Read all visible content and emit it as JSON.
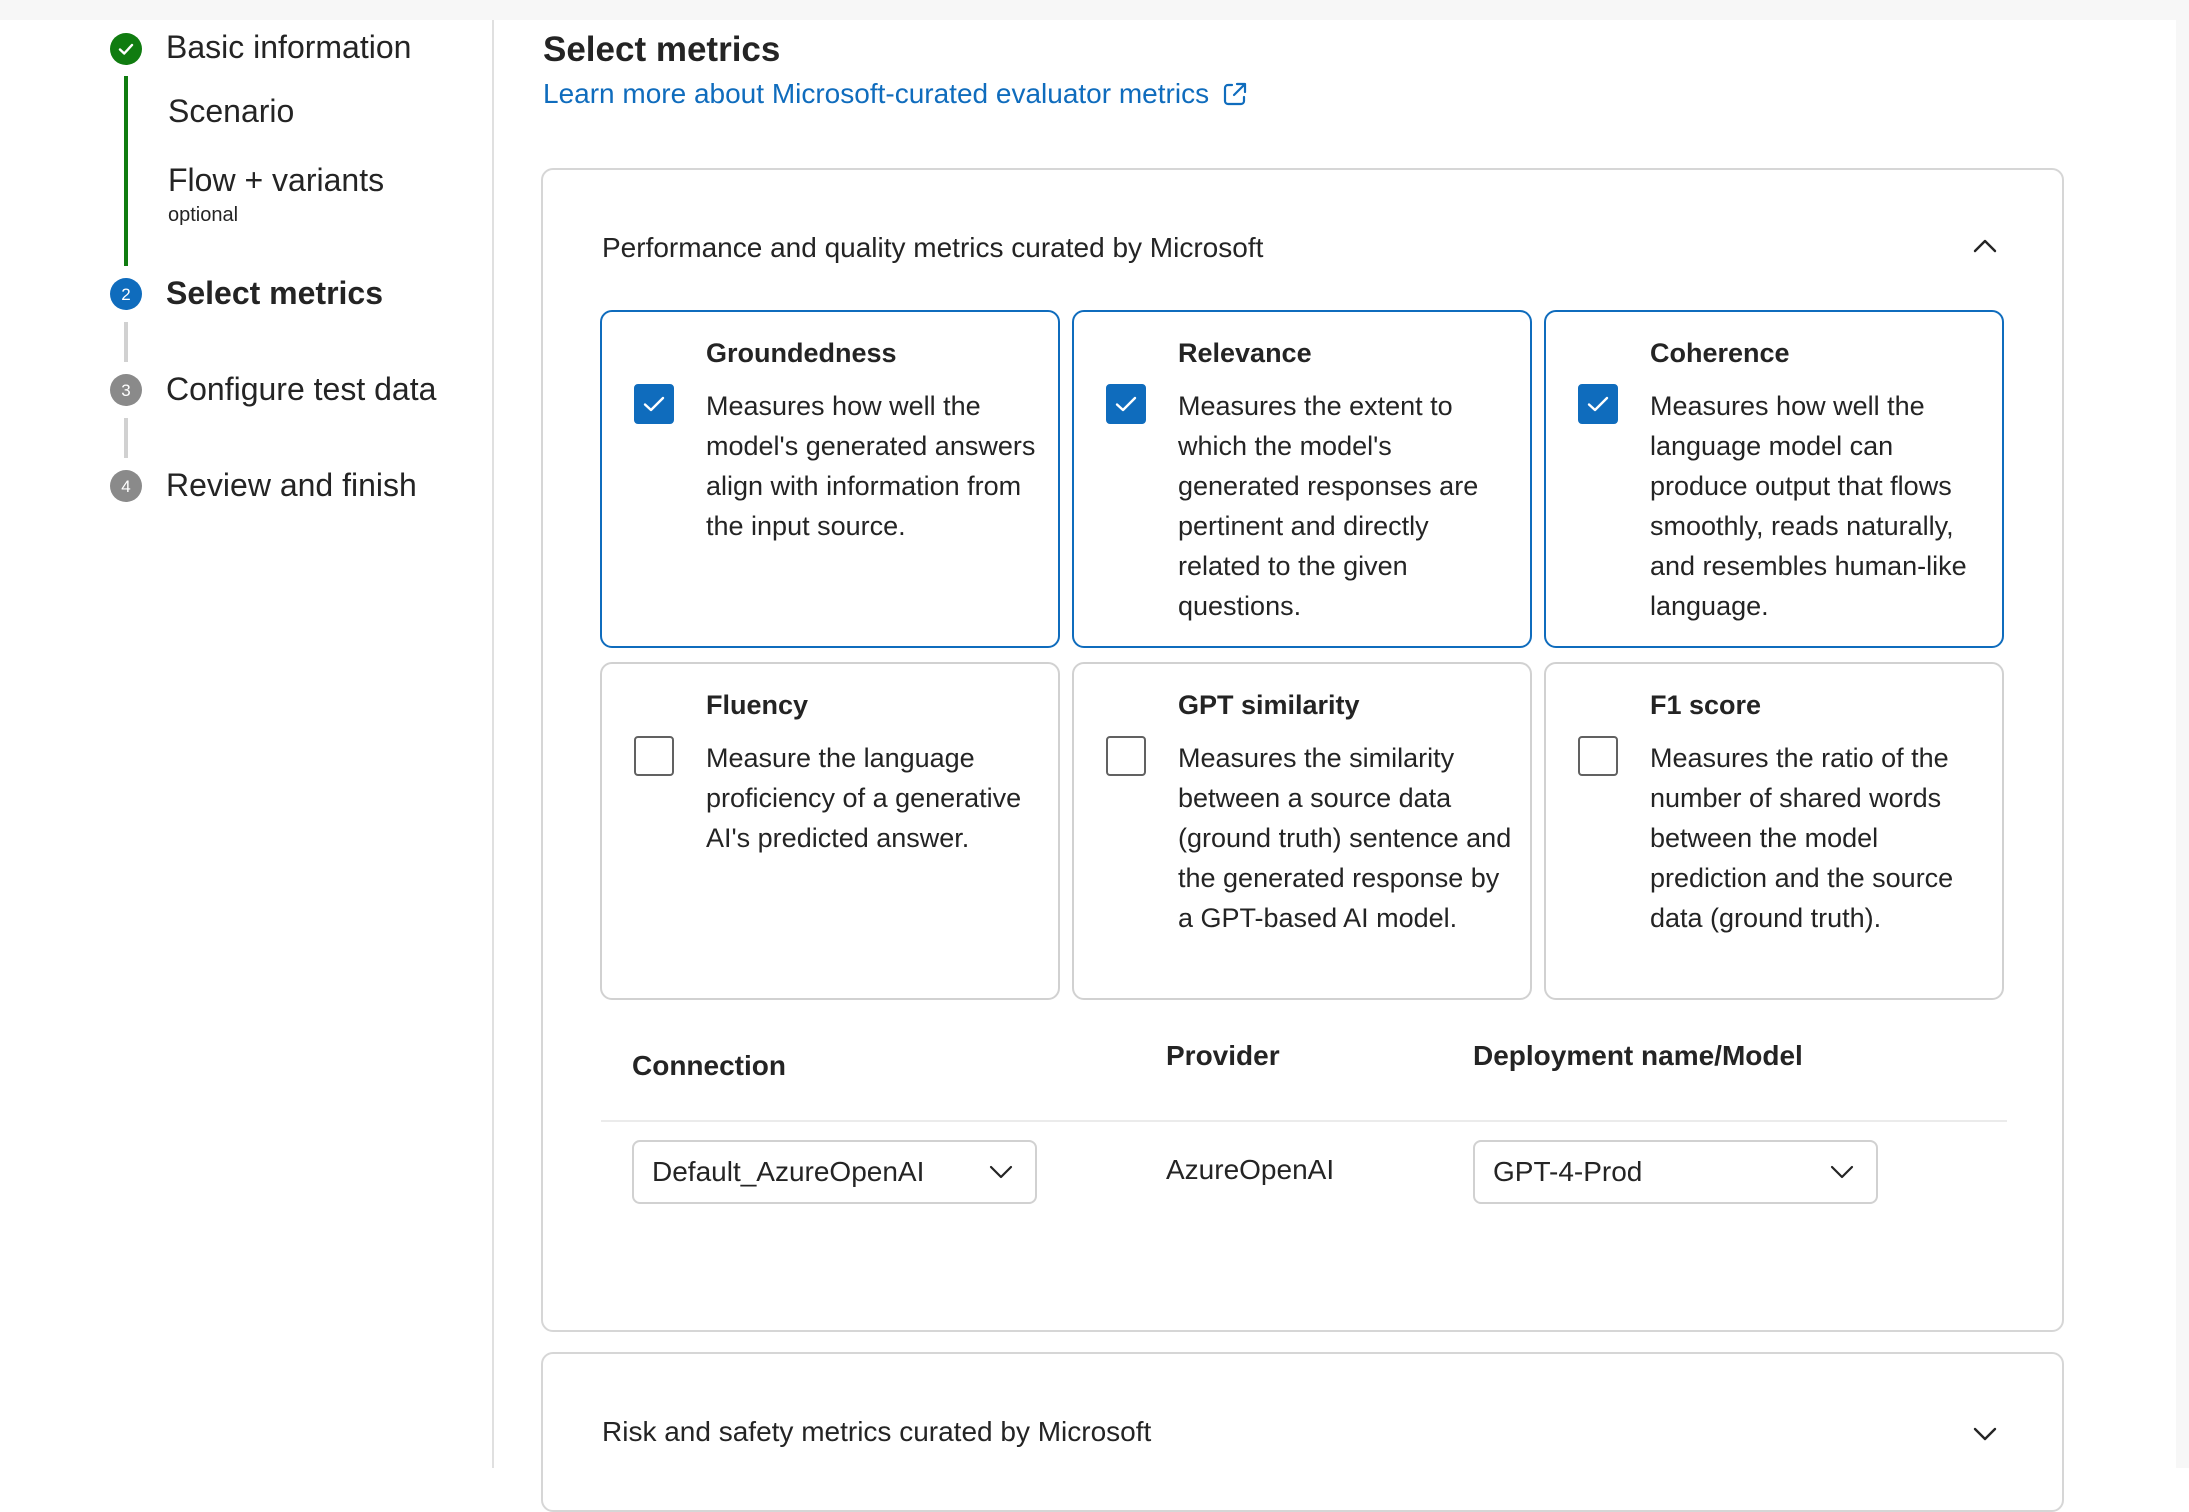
{
  "stepper": {
    "steps": [
      {
        "label": "Basic information",
        "number": "",
        "state": "completed"
      },
      {
        "label": "Scenario",
        "state": "completed-sub"
      },
      {
        "label": "Flow + variants",
        "sublabel": "optional",
        "state": "completed-sub"
      },
      {
        "label": "Select metrics",
        "number": "2",
        "state": "current"
      },
      {
        "label": "Configure test data",
        "number": "3",
        "state": "pending"
      },
      {
        "label": "Review and finish",
        "number": "4",
        "state": "pending"
      }
    ]
  },
  "main": {
    "title": "Select metrics",
    "learn_more_link": "Learn more about Microsoft-curated evaluator metrics",
    "performance_panel": {
      "title": "Performance and quality metrics curated by Microsoft",
      "expanded": true,
      "metrics": [
        {
          "title": "Groundedness",
          "description": "Measures how well the model's generated answers align with information from the input source.",
          "checked": true
        },
        {
          "title": "Relevance",
          "description": "Measures the extent to which the model's generated responses are pertinent and directly related to the given questions.",
          "checked": true
        },
        {
          "title": "Coherence",
          "description": "Measures how well the language model can produce output that flows smoothly, reads naturally, and resembles human-like language.",
          "checked": true
        },
        {
          "title": "Fluency",
          "description": "Measure the language proficiency of a generative AI's predicted answer.",
          "checked": false
        },
        {
          "title": "GPT similarity",
          "description": "Measures the similarity between a source data (ground truth) sentence and the generated response by a GPT-based AI model.",
          "checked": false
        },
        {
          "title": "F1 score",
          "description": "Measures the ratio of the number of shared words between the model prediction and the source data (ground truth).",
          "checked": false
        }
      ],
      "table": {
        "headers": {
          "connection": "Connection",
          "provider": "Provider",
          "deployment": "Deployment name/Model"
        },
        "connection_value": "Default_AzureOpenAI",
        "provider_value": "AzureOpenAI",
        "deployment_value": "GPT-4-Prod"
      }
    },
    "risk_panel": {
      "title": "Risk and safety metrics curated by Microsoft",
      "expanded": false
    }
  },
  "colors": {
    "accent": "#0f6cbd",
    "success": "#107c10",
    "pending": "#8a8a8a",
    "border": "#d1d1d1"
  },
  "icons": {
    "completed_step": "checkmark-circle-icon",
    "external_link": "open-external-icon",
    "collapse": "chevron-up-icon",
    "expand": "chevron-down-icon",
    "checkbox_checked": "checkmark-icon"
  }
}
